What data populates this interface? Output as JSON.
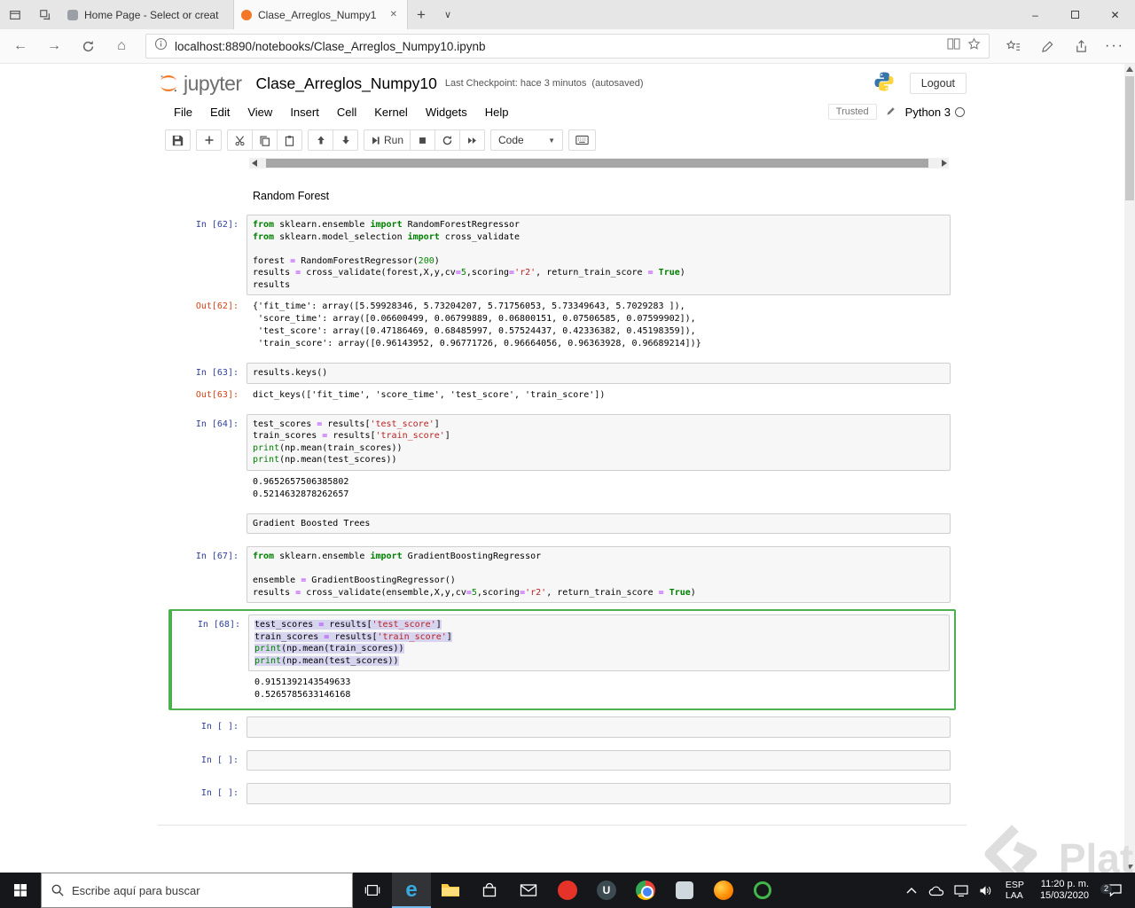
{
  "browser": {
    "tabs": [
      {
        "label": "Home Page - Select or creat"
      },
      {
        "label": "Clase_Arreglos_Numpy1"
      }
    ],
    "url": "localhost:8890/notebooks/Clase_Arreglos_Numpy10.ipynb"
  },
  "icons": {
    "minimize": "–",
    "close": "✕",
    "tab_close": "✕",
    "new_tab": "+",
    "tab_caret": "∨",
    "back": "←",
    "forward": "→",
    "home": "⌂",
    "more": "···"
  },
  "jupyter": {
    "logo_text": "jupyter",
    "title": "Clase_Arreglos_Numpy10",
    "checkpoint": "Last Checkpoint: hace 3 minutos",
    "autosaved": "(autosaved)",
    "logout": "Logout",
    "menu": [
      "File",
      "Edit",
      "View",
      "Insert",
      "Cell",
      "Kernel",
      "Widgets",
      "Help"
    ],
    "trusted": "Trusted",
    "kernel_name": "Python 3",
    "run_label": "Run",
    "cell_type": "Code"
  },
  "colors": {
    "prompt_in": "#303f9f",
    "prompt_out": "#d84315",
    "selected_cell_border": "#4caf50",
    "selection_bg": "#d7d4f0",
    "keyword": "#008000",
    "string": "#ba2121",
    "number": "#008000",
    "operator": "#aa22ff",
    "jupyter_orange": "#f37726"
  },
  "notebook": {
    "cells": [
      {
        "kind": "markdown",
        "text": "Random Forest"
      },
      {
        "kind": "code",
        "in": "In [62]:",
        "out": "Out[62]:",
        "source": [
          "from sklearn.ensemble import RandomForestRegressor",
          "from sklearn.model_selection import cross_validate",
          "",
          "forest = RandomForestRegressor(200)",
          "results = cross_validate(forest,X,y,cv=5,scoring='r2', return_train_score = True)",
          "results"
        ],
        "outputs": [
          "{'fit_time': array([5.59928346, 5.73204207, 5.71756053, 5.73349643, 5.7029283 ]),",
          " 'score_time': array([0.06600499, 0.06799889, 0.06800151, 0.07506585, 0.07599902]),",
          " 'test_score': array([0.47186469, 0.68485997, 0.57524437, 0.42336382, 0.45198359]),",
          " 'train_score': array([0.96143952, 0.96771726, 0.96664056, 0.96363928, 0.96689214])}"
        ]
      },
      {
        "kind": "code",
        "in": "In [63]:",
        "out": "Out[63]:",
        "source": [
          "results.keys()"
        ],
        "outputs": [
          "dict_keys(['fit_time', 'score_time', 'test_score', 'train_score'])"
        ]
      },
      {
        "kind": "code",
        "in": "In [64]:",
        "out": "",
        "source": [
          "test_scores = results['test_score']",
          "train_scores = results['train_score']",
          "print(np.mean(train_scores))",
          "print(np.mean(test_scores))"
        ],
        "outputs": [
          "0.9652657506385802",
          "0.5214632878262657"
        ]
      },
      {
        "kind": "raw",
        "text": "Gradient Boosted Trees"
      },
      {
        "kind": "code",
        "in": "In [67]:",
        "out": "",
        "source": [
          "from sklearn.ensemble import GradientBoostingRegressor",
          "",
          "ensemble = GradientBoostingRegressor()",
          "results = cross_validate(ensemble,X,y,cv=5,scoring='r2', return_train_score = True)"
        ],
        "outputs": []
      },
      {
        "kind": "code",
        "in": "In [68]:",
        "out": "",
        "selected": true,
        "selection": true,
        "source": [
          "test_scores = results['test_score']",
          "train_scores = results['train_score']",
          "print(np.mean(train_scores))",
          "print(np.mean(test_scores))"
        ],
        "outputs": [
          "0.9151392143549633",
          "0.5265785633146168"
        ]
      },
      {
        "kind": "code",
        "in": "In [ ]:",
        "out": "",
        "source": [
          ""
        ],
        "outputs": []
      },
      {
        "kind": "code",
        "in": "In [ ]:",
        "out": "",
        "source": [
          ""
        ],
        "outputs": []
      },
      {
        "kind": "code",
        "in": "In [ ]:",
        "out": "",
        "source": [
          ""
        ],
        "outputs": []
      }
    ]
  },
  "taskbar": {
    "search_placeholder": "Escribe aquí para buscar",
    "tray": {
      "lang_top": "ESP",
      "lang_bottom": "LAA",
      "time": "11:20 p. m.",
      "date": "15/03/2020",
      "badge": "2"
    }
  },
  "watermark": "Platzi"
}
